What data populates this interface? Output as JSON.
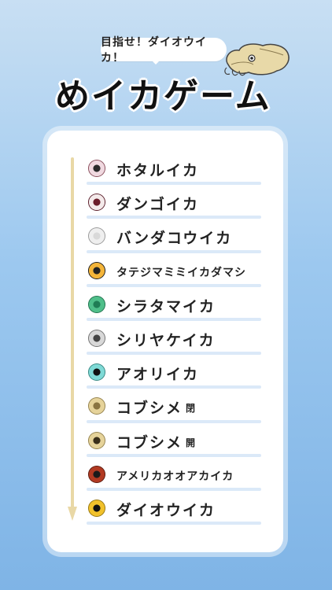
{
  "header": {
    "subtitle": "目指せ！ダイオウイカ！",
    "title": "めイカゲーム"
  },
  "list": [
    {
      "label": "ホタルイカ",
      "icon": "eye-firefly-squid",
      "iris": "#f0d9e0",
      "pupil": "#2a2a2a",
      "ring": "#b8677a"
    },
    {
      "label": "ダンゴイカ",
      "icon": "eye-bobtail-squid",
      "iris": "#f4eaea",
      "pupil": "#6b1d2a",
      "ring": "#7a2a3a"
    },
    {
      "label": "バンダコウイカ",
      "icon": "eye-bandakou-squid",
      "iris": "#efefef",
      "pupil": "#d9d9d9",
      "ring": "#cfcfcf"
    },
    {
      "label": "タテジマミミイカダマシ",
      "icon": "eye-striped-pygmy-squid",
      "iris": "#f4b53a",
      "pupil": "#222",
      "ring": "#222",
      "small": true
    },
    {
      "label": "シラタマイカ",
      "icon": "eye-shiratama-squid",
      "iris": "#4fbf8a",
      "pupil": "#1f7d55",
      "ring": "#2e9a6a"
    },
    {
      "label": "シリヤケイカ",
      "icon": "eye-shiriyake-squid",
      "iris": "#d8d8d8",
      "pupil": "#444",
      "ring": "#9a9a9a"
    },
    {
      "label": "アオリイカ",
      "icon": "eye-bigfin-reef-squid",
      "iris": "#7fdad6",
      "pupil": "#111",
      "ring": "#4cb7b0"
    },
    {
      "label": "コブシメ",
      "tag": "閉",
      "icon": "eye-cuttlefish-closed",
      "iris": "#e6d39a",
      "pupil": "#8a7440",
      "ring": "#c8b06a"
    },
    {
      "label": "コブシメ",
      "tag": "開",
      "icon": "eye-cuttlefish-open",
      "iris": "#e6d39a",
      "pupil": "#3a2f1a",
      "ring": "#c8b06a"
    },
    {
      "label": "アメリカオオアカイカ",
      "icon": "eye-humboldt-squid",
      "iris": "#b23a22",
      "pupil": "#1a1a1a",
      "ring": "#7a2414",
      "small": true
    },
    {
      "label": "ダイオウイカ",
      "icon": "eye-giant-squid",
      "iris": "#f1c12b",
      "pupil": "#111",
      "ring": "#caa019"
    }
  ],
  "colors": {
    "arrow": "#e9d8a6",
    "rule": "#dbe9f8",
    "panel": "#ffffff",
    "background_top": "#c8dff3",
    "background_bottom": "#7fb4e6"
  }
}
